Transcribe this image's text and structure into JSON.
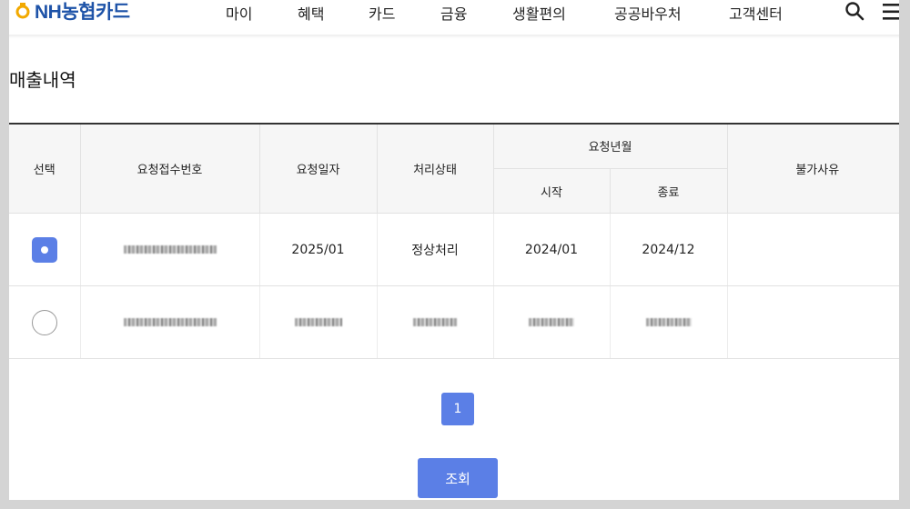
{
  "header": {
    "logo_text": "NH농협카드",
    "nav": [
      "마이",
      "혜택",
      "카드",
      "금융",
      "생활편의",
      "공공바우처",
      "고객센터"
    ],
    "search_icon": "search-icon",
    "menu_icon": "hamburger-menu-icon"
  },
  "page": {
    "title": "매출내역"
  },
  "table": {
    "headers": {
      "select": "선택",
      "request_no": "요청접수번호",
      "request_date": "요청일자",
      "status": "처리상태",
      "period": "요청년월",
      "start": "시작",
      "end": "종료",
      "reason": "불가사유"
    },
    "rows": [
      {
        "selected": true,
        "request_date": "2025/01",
        "status": "정상처리",
        "start": "2024/01",
        "end": "2024/12",
        "reason": ""
      },
      {
        "selected": false,
        "request_date": "",
        "status": "",
        "start": "",
        "end": "",
        "reason": ""
      }
    ]
  },
  "pagination": {
    "current": "1"
  },
  "actions": {
    "query_label": "조회"
  },
  "colors": {
    "accent": "#5b7fe6",
    "brand": "#1e53a8",
    "frame": "#d4d4d4"
  }
}
